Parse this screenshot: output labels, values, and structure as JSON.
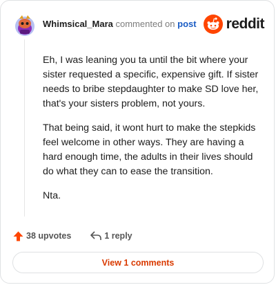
{
  "comment": {
    "username": "Whimsical_Mara",
    "commented_text": "commented on",
    "post_link": "post",
    "paragraphs": [
      "Eh, I was leaning you ta until the bit where your sister requested a specific, expensive gift. If sister needs to bribe stepdaughter to make SD love her, that's your sisters problem, not yours.",
      "That being said, it wont hurt to make the stepkids feel welcome in other ways. They are having a hard enough time, the adults in their lives should do what they can to ease the transition.",
      "Nta."
    ],
    "upvotes": "38 upvotes",
    "replies": "1 reply",
    "view_comments": "View 1 comments"
  },
  "brand": {
    "logo_text": "reddit",
    "accent": "#ff4500",
    "link": "#1a5cc4",
    "upvote": "#ff4500",
    "view": "#d93a00"
  },
  "icons": [
    "avatar",
    "reddit-logo-icon",
    "upvote-arrow-icon",
    "reply-arrow-icon"
  ]
}
